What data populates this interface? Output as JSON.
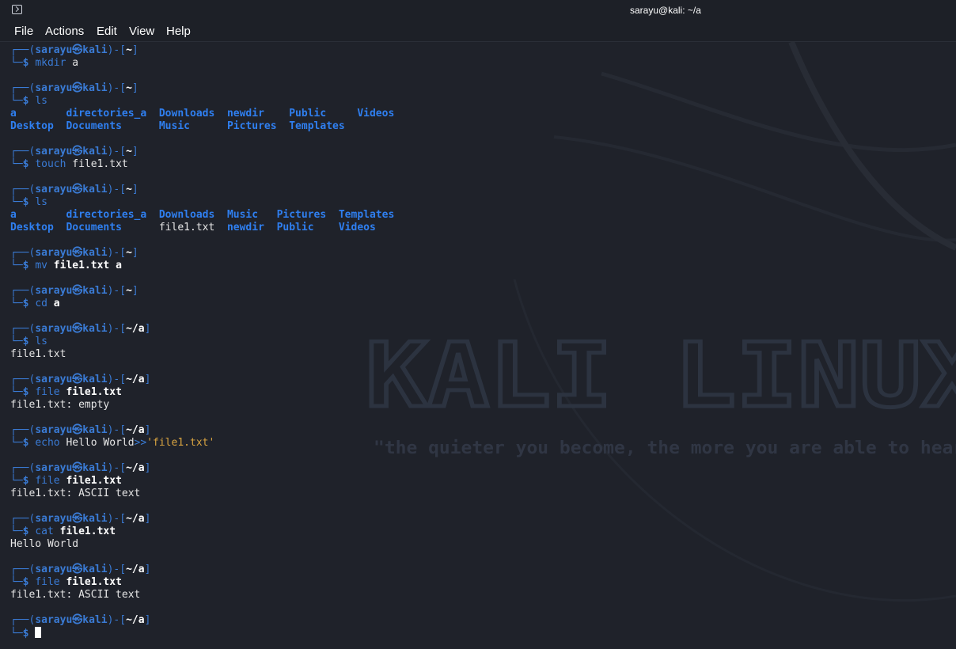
{
  "window": {
    "title": "sarayu@kali: ~/a"
  },
  "menu": [
    "File",
    "Actions",
    "Edit",
    "View",
    "Help"
  ],
  "background": {
    "watermark": "KALI LINUX",
    "tagline": "\"the quieter you become, the more you are able to hear\""
  },
  "prompt": {
    "user": "sarayu",
    "at": "㉿",
    "host": "kali"
  },
  "lines": [
    {
      "t": "prompt",
      "dir": "~"
    },
    {
      "t": "cmd",
      "parts": [
        {
          "k": "cmd",
          "v": "mkdir"
        },
        {
          "k": "plain",
          "v": " a"
        }
      ]
    },
    {
      "t": "blank"
    },
    {
      "t": "prompt",
      "dir": "~"
    },
    {
      "t": "cmd",
      "parts": [
        {
          "k": "cmd",
          "v": "ls"
        }
      ]
    },
    {
      "t": "ls",
      "items": [
        {
          "name": "a",
          "type": "dir"
        },
        {
          "name": "directories_a",
          "type": "dir"
        },
        {
          "name": "Downloads",
          "type": "dir"
        },
        {
          "name": "newdir",
          "type": "dir"
        },
        {
          "name": "Public",
          "type": "dir"
        },
        {
          "name": "Videos",
          "type": "dir"
        }
      ]
    },
    {
      "t": "ls",
      "items": [
        {
          "name": "Desktop",
          "type": "dir"
        },
        {
          "name": "Documents",
          "type": "dir"
        },
        {
          "name": "Music",
          "type": "dir"
        },
        {
          "name": "Pictures",
          "type": "dir"
        },
        {
          "name": "Templates",
          "type": "dir"
        }
      ]
    },
    {
      "t": "blank"
    },
    {
      "t": "prompt",
      "dir": "~"
    },
    {
      "t": "cmd",
      "parts": [
        {
          "k": "cmd",
          "v": "touch"
        },
        {
          "k": "plain",
          "v": " file1.txt"
        }
      ]
    },
    {
      "t": "blank"
    },
    {
      "t": "prompt",
      "dir": "~"
    },
    {
      "t": "cmd",
      "parts": [
        {
          "k": "cmd",
          "v": "ls"
        }
      ]
    },
    {
      "t": "ls",
      "items": [
        {
          "name": "a",
          "type": "dir"
        },
        {
          "name": "directories_a",
          "type": "dir"
        },
        {
          "name": "Downloads",
          "type": "dir"
        },
        {
          "name": "Music",
          "type": "dir"
        },
        {
          "name": "Pictures",
          "type": "dir"
        },
        {
          "name": "Templates",
          "type": "dir"
        }
      ]
    },
    {
      "t": "ls",
      "items": [
        {
          "name": "Desktop",
          "type": "dir"
        },
        {
          "name": "Documents",
          "type": "dir"
        },
        {
          "name": "file1.txt",
          "type": "file"
        },
        {
          "name": "newdir",
          "type": "dir"
        },
        {
          "name": "Public",
          "type": "dir"
        },
        {
          "name": "Videos",
          "type": "dir"
        }
      ]
    },
    {
      "t": "blank"
    },
    {
      "t": "prompt",
      "dir": "~"
    },
    {
      "t": "cmd",
      "parts": [
        {
          "k": "cmd",
          "v": "mv"
        },
        {
          "k": "plain",
          "v": " "
        },
        {
          "k": "bold",
          "v": "file1.txt"
        },
        {
          "k": "plain",
          "v": " "
        },
        {
          "k": "bold",
          "v": "a"
        }
      ]
    },
    {
      "t": "blank"
    },
    {
      "t": "prompt",
      "dir": "~"
    },
    {
      "t": "cmd",
      "parts": [
        {
          "k": "cmd",
          "v": "cd"
        },
        {
          "k": "plain",
          "v": " "
        },
        {
          "k": "bold",
          "v": "a"
        }
      ]
    },
    {
      "t": "blank"
    },
    {
      "t": "prompt",
      "dir": "~/a"
    },
    {
      "t": "cmd",
      "parts": [
        {
          "k": "cmd",
          "v": "ls"
        }
      ]
    },
    {
      "t": "out",
      "v": "file1.txt"
    },
    {
      "t": "blank"
    },
    {
      "t": "prompt",
      "dir": "~/a"
    },
    {
      "t": "cmd",
      "parts": [
        {
          "k": "cmd",
          "v": "file"
        },
        {
          "k": "plain",
          "v": " "
        },
        {
          "k": "bold",
          "v": "file1.txt"
        }
      ]
    },
    {
      "t": "out",
      "v": "file1.txt: empty"
    },
    {
      "t": "blank"
    },
    {
      "t": "prompt",
      "dir": "~/a"
    },
    {
      "t": "cmd",
      "parts": [
        {
          "k": "cmd",
          "v": "echo"
        },
        {
          "k": "plain",
          "v": " Hello World"
        },
        {
          "k": "op",
          "v": ">>"
        },
        {
          "k": "str",
          "v": "'file1.txt'"
        }
      ]
    },
    {
      "t": "blank"
    },
    {
      "t": "prompt",
      "dir": "~/a"
    },
    {
      "t": "cmd",
      "parts": [
        {
          "k": "cmd",
          "v": "file"
        },
        {
          "k": "plain",
          "v": " "
        },
        {
          "k": "bold",
          "v": "file1.txt"
        }
      ]
    },
    {
      "t": "out",
      "v": "file1.txt: ASCII text"
    },
    {
      "t": "blank"
    },
    {
      "t": "prompt",
      "dir": "~/a"
    },
    {
      "t": "cmd",
      "parts": [
        {
          "k": "cmd",
          "v": "cat"
        },
        {
          "k": "plain",
          "v": " "
        },
        {
          "k": "bold",
          "v": "file1.txt"
        }
      ]
    },
    {
      "t": "out",
      "v": "Hello World"
    },
    {
      "t": "blank"
    },
    {
      "t": "prompt",
      "dir": "~/a"
    },
    {
      "t": "cmd",
      "parts": [
        {
          "k": "cmd",
          "v": "file"
        },
        {
          "k": "plain",
          "v": " "
        },
        {
          "k": "bold",
          "v": "file1.txt"
        }
      ]
    },
    {
      "t": "out",
      "v": "file1.txt: ASCII text"
    },
    {
      "t": "blank"
    },
    {
      "t": "prompt",
      "dir": "~/a"
    },
    {
      "t": "cursor"
    }
  ],
  "colors": {
    "background": "#1f222a",
    "prompt_blue": "#3a7bd5",
    "dir_blue": "#2f7ff0",
    "string_orange": "#d9a441"
  }
}
